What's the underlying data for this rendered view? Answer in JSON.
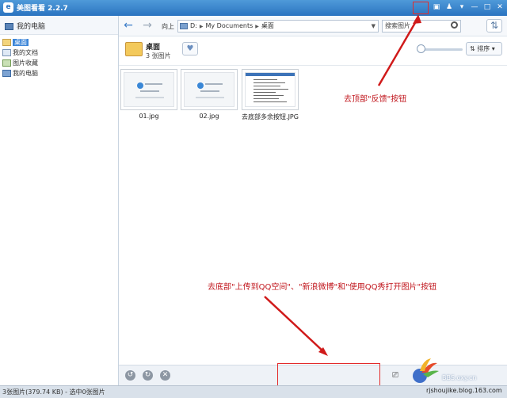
{
  "window": {
    "title": "美图看看 2.2.7",
    "controls": {
      "menu": "▾",
      "minimize": "—",
      "maximize": "□",
      "close": "✕"
    }
  },
  "sidebar": {
    "header": "我的电脑",
    "items": [
      {
        "label": "桌面",
        "icon": "folder-icon",
        "selected": true
      },
      {
        "label": "我的文档",
        "icon": "documents-icon",
        "selected": false
      },
      {
        "label": "图片收藏",
        "icon": "pictures-icon",
        "selected": false
      },
      {
        "label": "我的电脑",
        "icon": "computer-icon",
        "selected": false
      }
    ]
  },
  "toolbar": {
    "back": "←",
    "forward": "→",
    "up_label": "向上",
    "path": [
      "D:",
      "My Documents",
      "桌面"
    ],
    "search_placeholder": "搜索图片",
    "refresh": "⇅"
  },
  "folder": {
    "name": "桌面",
    "count": "3 张图片",
    "favorite_icon": "heart-icon",
    "sort_label": "排序",
    "zoom_level": 0.05
  },
  "thumbnails": [
    {
      "label": "01.jpg"
    },
    {
      "label": "02.jpg"
    },
    {
      "label": "去底部多余按钮.JPG"
    }
  ],
  "annotations": {
    "top": "去顶部\"反馈\"按钮",
    "bottom": "去底部\"上传到QQ空间\"、\"新浪微博\"和\"使用QQ秀打开图片\"按钮"
  },
  "colors": {
    "annotation": "#c0141b",
    "titlebar": "#2a73c0",
    "highlight_box": "#e32b2b"
  },
  "status": "3张图片(379.74 KB) - 选中0张图片",
  "watermark": {
    "site": "BBS.oxy.cn",
    "blog": "rjshoujike.blog.163.com"
  }
}
